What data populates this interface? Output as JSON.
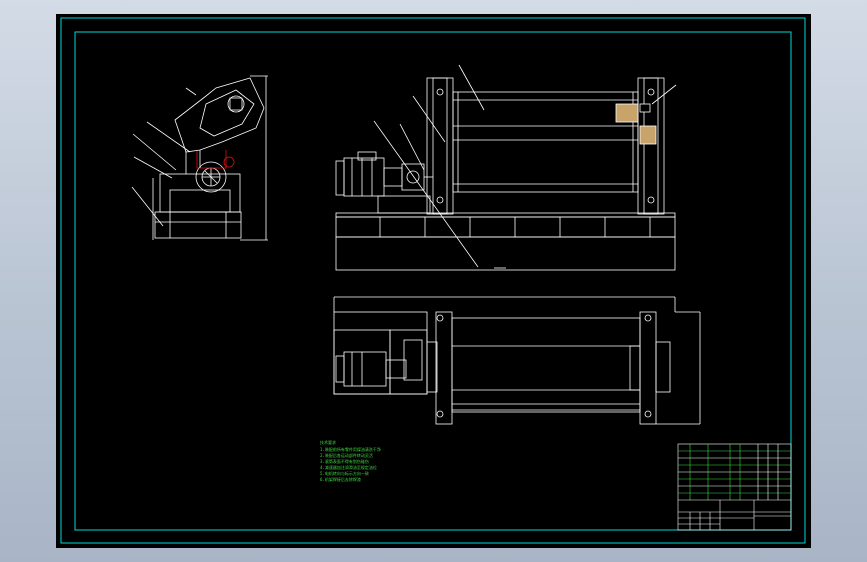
{
  "app": {
    "background": "#000000",
    "paper_bg": "#b9c4d3"
  },
  "colors": {
    "frame": "#00d8d8",
    "linework": "#ffffff",
    "leader": "#ffffff",
    "highlight": "#e01010",
    "notes": "#3ddc3d",
    "hatch": "#c8a46a"
  },
  "drawing": {
    "name": "roller-machine-assembly",
    "views": [
      "side-view",
      "front-elevation",
      "top-plan"
    ],
    "balloon_count": 9
  },
  "notes": {
    "heading": "技术要求",
    "lines": [
      "1.装配前所有零件用煤油清洗干净",
      "2.装配后各运动部件转动灵活",
      "3.滚筒表面不得有划伤碰伤",
      "4.减速器加注润滑油至规定油位",
      "5.电机转向与标示方向一致",
      "6.机架焊接后去除焊渣",
      "7.外露表面涂防锈漆"
    ]
  },
  "title_block": {
    "rows": 8
  }
}
